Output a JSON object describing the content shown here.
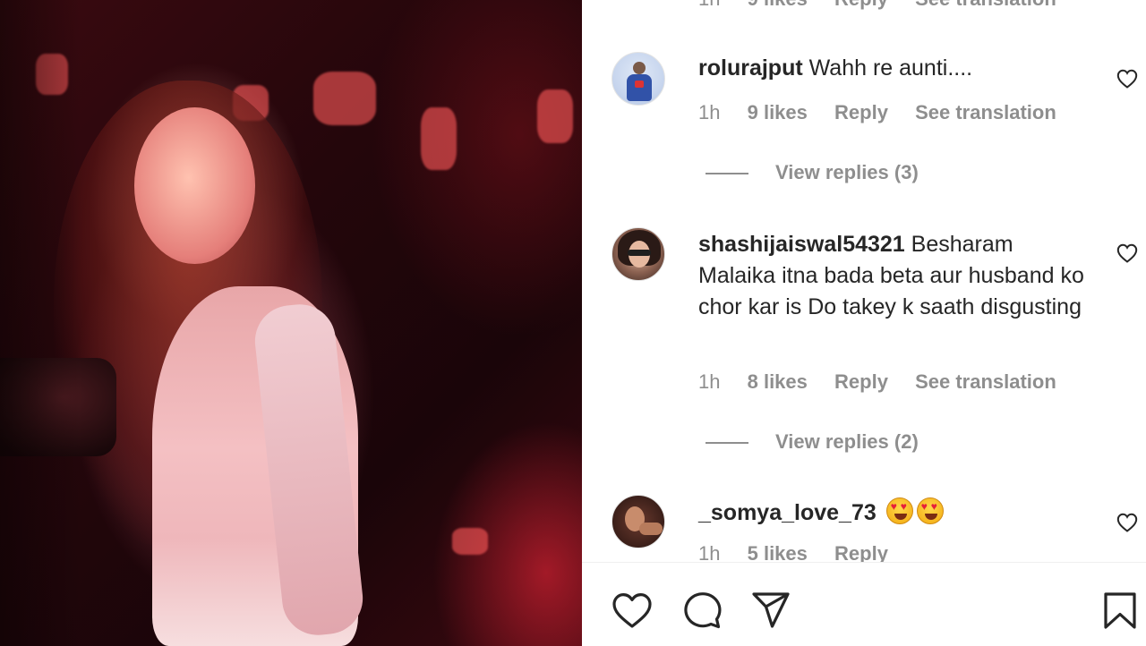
{
  "comments": [
    {
      "username": "",
      "text": "",
      "time": "1h",
      "likes": "9 likes",
      "reply": "Reply",
      "translate": "See translation",
      "partial": true
    },
    {
      "username": "rolurajput",
      "text": "Wahh re aunti....",
      "time": "1h",
      "likes": "9 likes",
      "reply": "Reply",
      "translate": "See translation",
      "view_replies": "View replies (3)"
    },
    {
      "username": "shashijaiswal54321",
      "text": "Besharam Malaika itna bada beta aur husband ko chor kar is Do takey k saath disgusting",
      "time": "1h",
      "likes": "8 likes",
      "reply": "Reply",
      "translate": "See translation",
      "view_replies": "View replies (2)"
    },
    {
      "username": "_somya_love_73",
      "text": "",
      "emojis": [
        "heart-eyes-emoji",
        "heart-eyes-emoji"
      ],
      "time": "1h",
      "likes": "5 likes",
      "reply": "Reply",
      "partial": true
    }
  ],
  "actions": {
    "icons": [
      "heart-icon",
      "comment-icon",
      "share-icon",
      "save-icon"
    ]
  },
  "colors": {
    "text": "#262626",
    "secondary_text": "#8e8e8e",
    "divider": "#efefef",
    "background": "#ffffff"
  }
}
